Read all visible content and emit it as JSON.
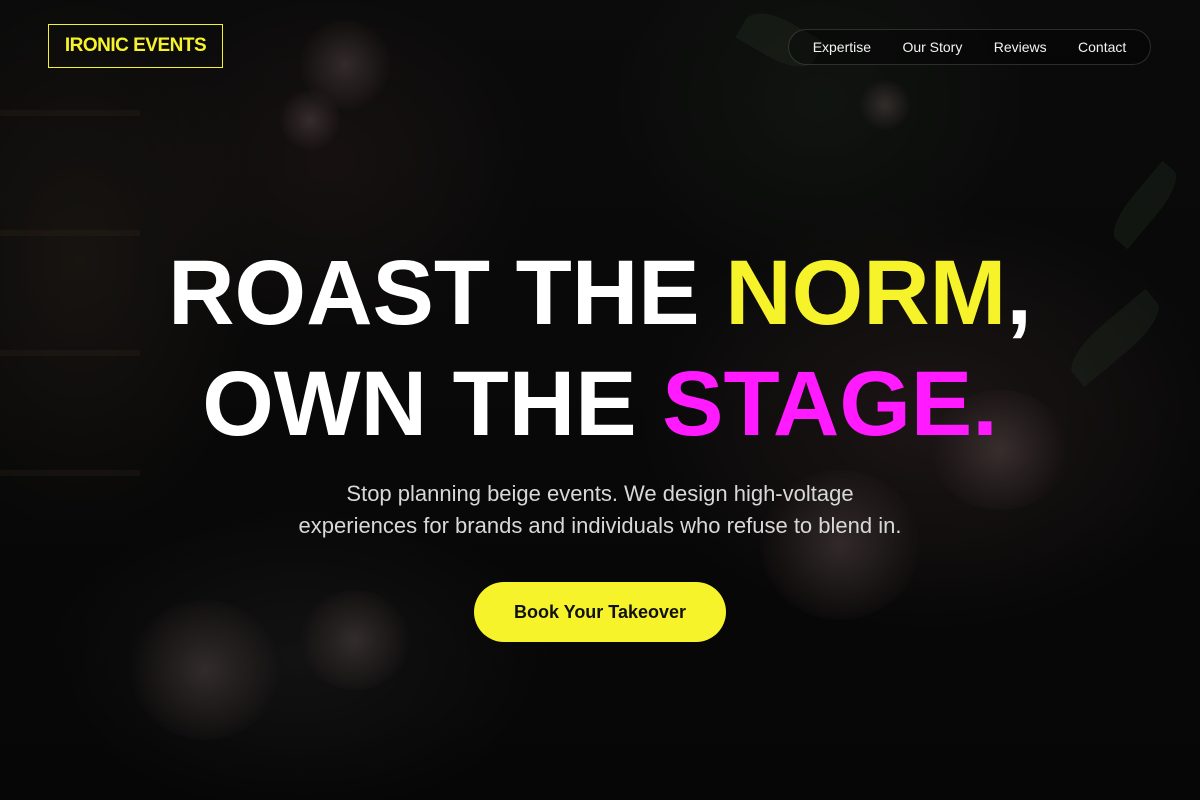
{
  "brand": {
    "logo_text": "IRONIC EVENTS",
    "accent_yellow": "#f7f32b",
    "accent_magenta": "#ff1aff"
  },
  "nav": {
    "items": [
      {
        "label": "Expertise"
      },
      {
        "label": "Our Story"
      },
      {
        "label": "Reviews"
      },
      {
        "label": "Contact"
      }
    ]
  },
  "hero": {
    "line1_white": "ROAST THE ",
    "line1_highlight": "NORM",
    "line1_end": ",",
    "line2_white": "OWN THE ",
    "line2_highlight": "STAGE.",
    "subtitle_line1": "Stop planning beige events. We design high-voltage",
    "subtitle_line2": "experiences for brands and individuals who refuse to blend in.",
    "cta_label": "Book Your Takeover"
  }
}
